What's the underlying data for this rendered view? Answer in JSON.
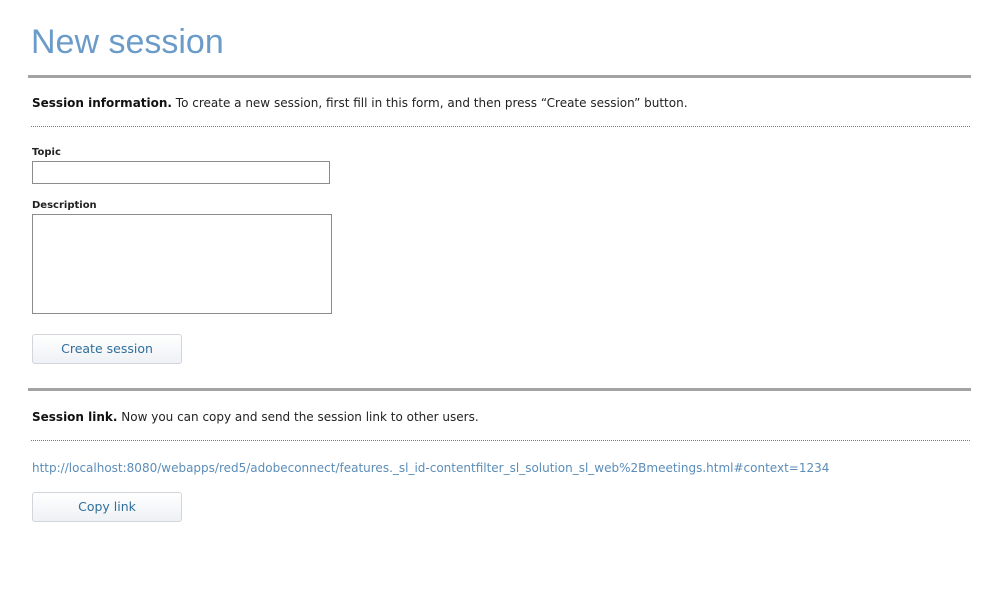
{
  "page": {
    "title": "New session"
  },
  "session_info": {
    "heading": "Session information.",
    "text": " To create a new session, first fill in this form, and then press “Create session” button."
  },
  "form": {
    "topic_label": "Topic",
    "topic_value": "",
    "description_label": "Description",
    "description_value": "",
    "create_button_label": "Create session"
  },
  "session_link": {
    "heading": "Session link.",
    "text": " Now you can copy and send the session link to other users.",
    "url": "http://localhost:8080/webapps/red5/adobeconnect/features._sl_id-contentfilter_sl_solution_sl_web%2Bmeetings.html#context=1234",
    "copy_button_label": "Copy link"
  },
  "colors": {
    "title": "#6b9bc8",
    "link": "#5b8db8",
    "button_text": "#2f6f9a",
    "rule": "#a3a3a3"
  }
}
